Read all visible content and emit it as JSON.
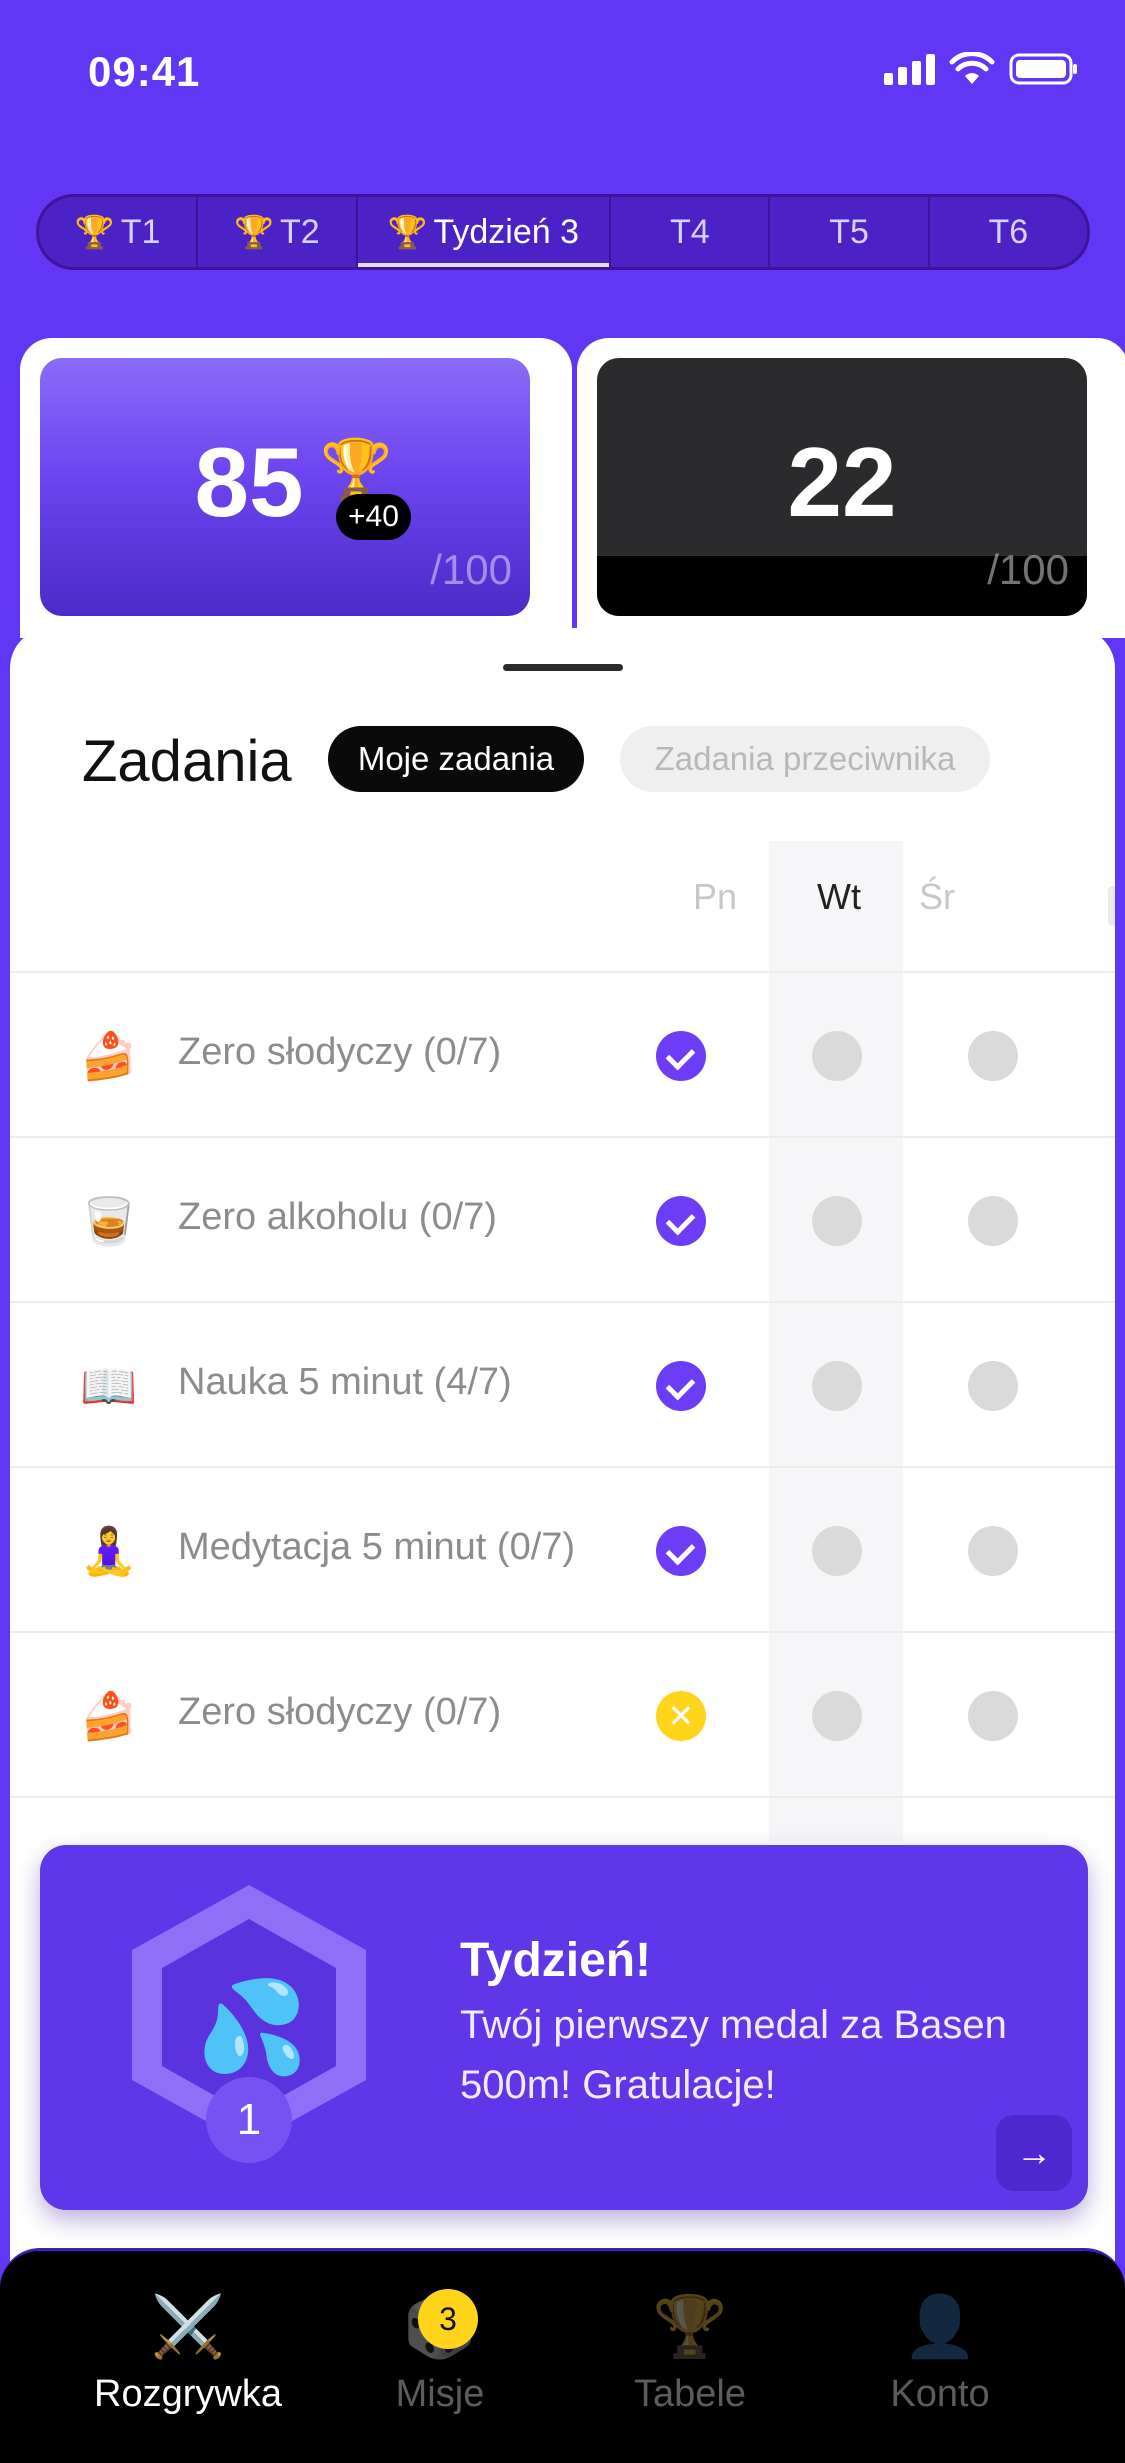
{
  "status_bar": {
    "time": "09:41"
  },
  "week_tabs": [
    {
      "label": "T1",
      "trophy": true,
      "active": false
    },
    {
      "label": "T2",
      "trophy": true,
      "active": false
    },
    {
      "label": "Tydzień 3",
      "trophy": true,
      "active": true
    },
    {
      "label": "T4",
      "trophy": false,
      "active": false
    },
    {
      "label": "T5",
      "trophy": false,
      "active": false
    },
    {
      "label": "T6",
      "trophy": false,
      "active": false
    }
  ],
  "scores": {
    "mine": {
      "value": "85",
      "max": "/100",
      "bonus": "+40"
    },
    "opponent": {
      "value": "22",
      "max": "/100"
    }
  },
  "tasks": {
    "title": "Zadania",
    "filter_mine": "Moje zadania",
    "filter_opponent": "Zadania przeciwnika",
    "days": [
      "Pn",
      "Wt",
      "Śr"
    ],
    "today": "Wt",
    "rows": [
      {
        "emoji": "🍰",
        "label": "Zero słodyczy (0/7)",
        "status": [
          "check",
          "empty",
          "empty"
        ]
      },
      {
        "emoji": "🥃",
        "label": "Zero alkoholu (0/7)",
        "status": [
          "check",
          "empty",
          "empty"
        ]
      },
      {
        "emoji": "📖",
        "label": "Nauka 5 minut (4/7)",
        "status": [
          "check",
          "empty",
          "empty"
        ]
      },
      {
        "emoji": "🧘‍♀️",
        "label": "Medytacja 5 minut (0/7)",
        "status": [
          "check",
          "empty",
          "empty"
        ]
      },
      {
        "emoji": "🍰",
        "label": "Zero słodyczy (0/7)",
        "status": [
          "fail",
          "empty",
          "empty"
        ]
      }
    ]
  },
  "medal_banner": {
    "title": "Tydzień!",
    "text": "Twój pierwszy medal za Basen 500m! Gratulacje!",
    "medal_number": "1",
    "arrow": "→"
  },
  "nav": {
    "items": [
      {
        "label": "Rozgrywka",
        "icon": "⚔️",
        "active": true
      },
      {
        "label": "Misje",
        "icon": "🎲",
        "active": false,
        "badge": "3"
      },
      {
        "label": "Tabele",
        "icon": "🏆",
        "active": false
      },
      {
        "label": "Konto",
        "icon": "👤",
        "active": false
      }
    ]
  },
  "colors": {
    "brand": "#6236F5",
    "check": "#6D3CF6",
    "fail": "#FFD51C"
  }
}
